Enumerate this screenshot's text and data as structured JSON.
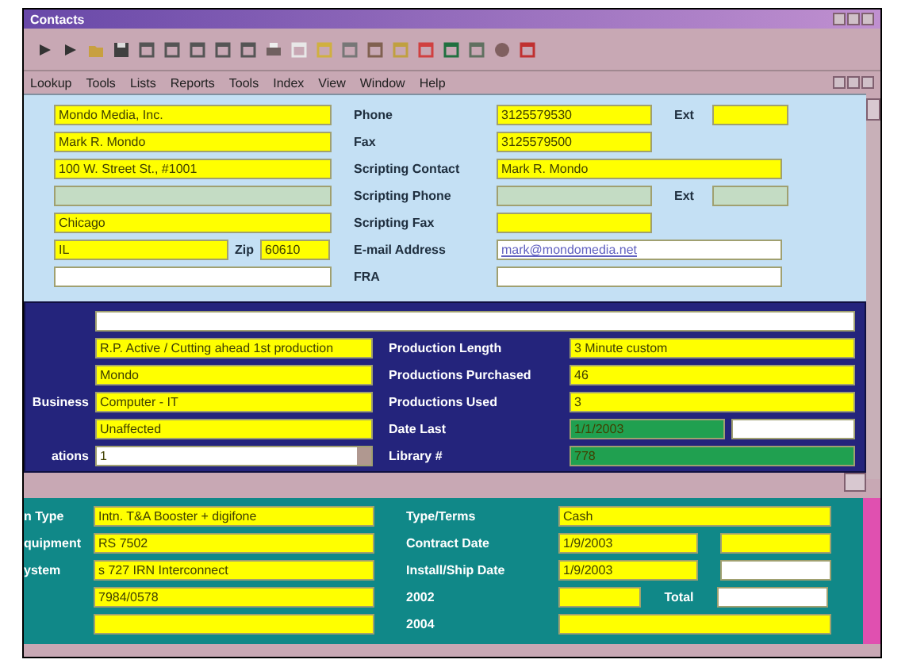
{
  "window": {
    "title": "Contacts"
  },
  "menu": [
    {
      "label": "Lookup"
    },
    {
      "label": "Tools"
    },
    {
      "label": "Lists"
    },
    {
      "label": "Reports"
    },
    {
      "label": "Tools"
    },
    {
      "label": "Index"
    },
    {
      "label": "View"
    },
    {
      "label": "Window"
    },
    {
      "label": "Help"
    }
  ],
  "contact_left": [
    {
      "value": "Mondo Media, Inc.",
      "color": "#ffff00"
    },
    {
      "value": "Mark R. Mondo",
      "color": "#ffff00"
    },
    {
      "value": "100 W. Street St., #1001",
      "color": "#ffff00"
    },
    {
      "color": "#c4dcc4"
    },
    {
      "value": "Chicago",
      "color": "#ffff00"
    },
    {
      "value": "IL",
      "color": "#ffff00",
      "zip_label": "Zip",
      "zip": {
        "value": "60610",
        "color": "#ffff00"
      }
    },
    {
      "color": "#ffffff"
    }
  ],
  "contact_right": [
    {
      "label": "Phone",
      "value": "3125579530",
      "color": "#ffff00",
      "ext": {
        "label": "Ext",
        "color": "#ffff00"
      }
    },
    {
      "label": "Fax",
      "value": "3125579500",
      "color": "#ffff00"
    },
    {
      "label": "Scripting Contact",
      "value": "Mark R. Mondo",
      "color": "#ffff00",
      "kind": "wide"
    },
    {
      "label": "Scripting Phone",
      "color": "#c4dcc4",
      "ext": {
        "label": "Ext",
        "color": "#c4dcc4"
      }
    },
    {
      "label": "Scripting Fax",
      "color": "#ffff00"
    },
    {
      "label": "E-mail Address",
      "value": "mark@mondomedia.net",
      "color": "#ffffff",
      "kind": "link"
    },
    {
      "label": "FRA",
      "color": "#ffffff",
      "kind": "wide"
    }
  ],
  "project_top": {
    "color": "#ffffff"
  },
  "project_left": [
    {
      "value": "R.P. Active / Cutting ahead 1st production",
      "color": "#ffff00"
    },
    {
      "value": "Mondo",
      "color": "#ffff00"
    },
    {
      "label": "Business",
      "value": "Computer - IT",
      "color": "#ffff00"
    },
    {
      "value": "Unaffected",
      "color": "#ffff00"
    },
    {
      "label": "ations",
      "value": "1",
      "color": "#ffffff",
      "kind": "dropdown"
    }
  ],
  "project_right": [
    {
      "label": "Production Length",
      "value": "3 Minute custom",
      "color": "#ffff00"
    },
    {
      "label": "Productions Purchased",
      "value": "46",
      "color": "#ffff00"
    },
    {
      "label": "Productions Used",
      "value": "3",
      "color": "#ffff00"
    },
    {
      "label": "Date Last",
      "value": "1/1/2003",
      "color": "#20a050",
      "extra": {
        "color": "#ffffff"
      }
    },
    {
      "label": "Library #",
      "value": "778",
      "color": "#20a050"
    }
  ],
  "equipment_left": [
    {
      "label": "n Type",
      "value": "Intn. T&A Booster + digifone",
      "color": "#ffff00"
    },
    {
      "label": "quipment",
      "value": "RS 7502",
      "color": "#ffff00"
    },
    {
      "label": "ystem",
      "value": "s 727 IRN Interconnect",
      "color": "#ffff00"
    },
    {
      "value": "7984/0578",
      "color": "#ffff00"
    },
    {
      "color": "#ffff00"
    }
  ],
  "equipment_right": [
    {
      "label": "Type/Terms",
      "value": "Cash",
      "color": "#ffff00"
    },
    {
      "label": "Contract Date",
      "value": "1/9/2003",
      "color": "#ffff00",
      "extra": {
        "color": "#ffff00"
      }
    },
    {
      "label": "Install/Ship Date",
      "value": "1/9/2003",
      "color": "#ffff00",
      "extra": {
        "color": "#ffffff"
      }
    },
    {
      "label": "2002",
      "color": "#ffff00",
      "kind": "short",
      "total_label": "Total",
      "extra": {
        "color": "#ffffff"
      }
    },
    {
      "label": "2004",
      "color": "#ffff00"
    }
  ]
}
